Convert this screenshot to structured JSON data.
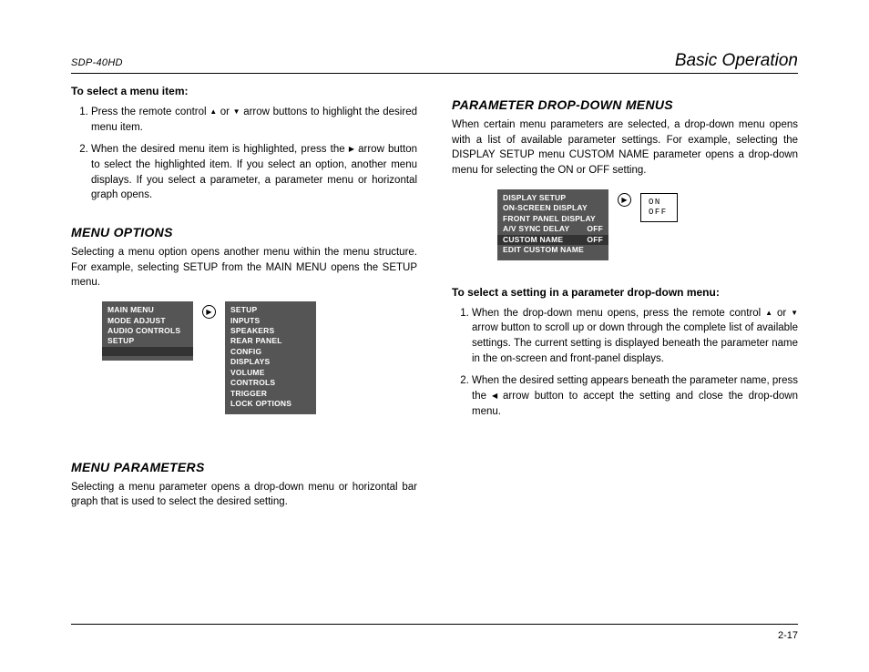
{
  "header": {
    "model": "SDP-40HD",
    "section": "Basic Operation"
  },
  "left": {
    "heading1": "To select a menu item:",
    "step1_a": "Press the remote control ",
    "step1_b": " or ",
    "step1_c": " arrow buttons to highlight the desired menu item.",
    "step2_a": "When the desired menu item is highlighted, press the ",
    "step2_b": " arrow button to select the highlighted item. If you select an option, another menu displays. If you select a parameter, a parameter menu or horizontal graph opens.",
    "menu_options_title": "MENU OPTIONS",
    "menu_options_body": "Selecting a menu option opens another menu within the menu structure. For example, selecting SETUP from the MAIN MENU opens the SETUP menu.",
    "main_menu": {
      "title": "MAIN MENU",
      "items": [
        "MODE ADJUST",
        "AUDIO CONTROLS",
        "SETUP"
      ]
    },
    "setup_menu": {
      "title": "SETUP",
      "items": [
        "INPUTS",
        "SPEAKERS",
        "REAR PANEL CONFIG",
        "DISPLAYS",
        "VOLUME CONTROLS",
        "TRIGGER",
        "LOCK OPTIONS"
      ]
    },
    "menu_params_title": "MENU PARAMETERS",
    "menu_params_body": "Selecting a menu parameter opens a drop-down menu or horizontal bar graph that is used to select the desired setting."
  },
  "right": {
    "dropdown_title": "PARAMETER DROP-DOWN MENUS",
    "dropdown_body": "When certain menu parameters are selected, a drop-down menu opens with a list of available parameter settings. For example, selecting the DISPLAY SETUP menu CUSTOM NAME parameter opens a drop-down menu for selecting the ON or OFF setting.",
    "display_setup": {
      "title": "DISPLAY SETUP",
      "r1": "ON-SCREEN DISPLAY",
      "r2": "FRONT PANEL DISPLAY",
      "r3": "A/V SYNC DELAY",
      "r3v": "OFF",
      "r4": "CUSTOM NAME",
      "r4v": "OFF",
      "r5": "EDIT CUSTOM NAME"
    },
    "dd_options": {
      "on": "ON",
      "off": "OFF"
    },
    "heading2": "To select a setting in a parameter drop-down menu:",
    "stepB1_a": "When the drop-down menu opens, press the remote control ",
    "stepB1_b": " or ",
    "stepB1_c": " arrow button to scroll up or down through the com­plete list of available settings. The current setting is displayed beneath the parameter name in the on-screen and front-panel displays.",
    "stepB2_a": "When the desired setting appears beneath the parameter name, press the ",
    "stepB2_b": " arrow button to accept the setting and close the drop-down menu."
  },
  "footer": {
    "page": "2-17"
  }
}
